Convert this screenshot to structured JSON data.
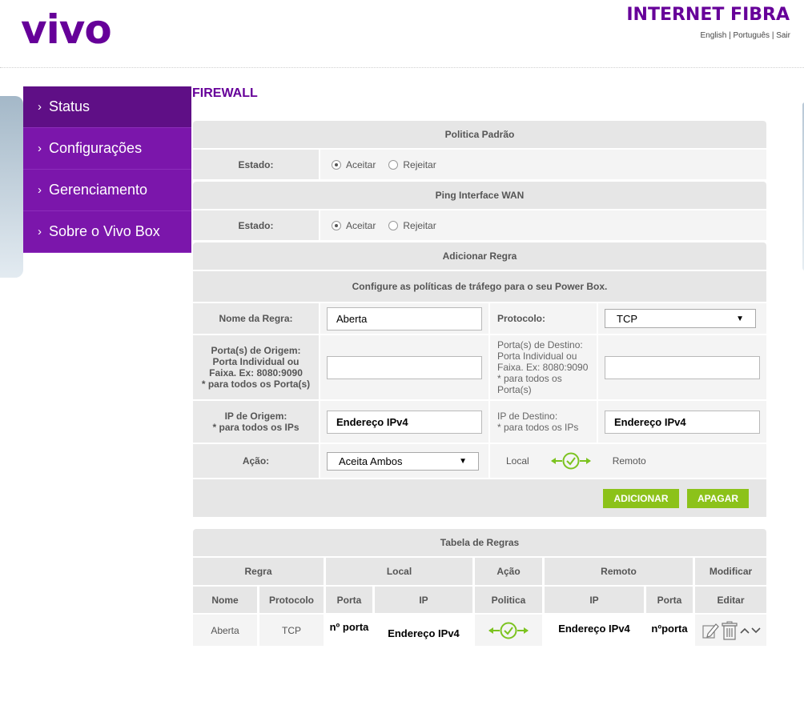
{
  "header": {
    "logo": "vivo",
    "brand": "INTERNET FIBRA",
    "languages": [
      "English",
      "Português",
      "Sair"
    ],
    "separator": " | "
  },
  "sidebar": {
    "items": [
      {
        "label": "Status",
        "active": true
      },
      {
        "label": "Configurações",
        "active": false
      },
      {
        "label": "Gerenciamento",
        "active": false
      },
      {
        "label": "Sobre o Vivo Box",
        "active": false
      }
    ]
  },
  "page": {
    "title": "FIREWALL"
  },
  "policy": {
    "header": "Politica Padrão",
    "state_label": "Estado:",
    "options": [
      "Aceitar",
      "Rejeitar"
    ],
    "selected": "Aceitar"
  },
  "ping": {
    "header": "Ping Interface WAN",
    "state_label": "Estado:",
    "options": [
      "Aceitar",
      "Rejeitar"
    ],
    "selected": "Aceitar"
  },
  "add_rule": {
    "header": "Adicionar Regra",
    "subheader": "Configure as políticas de tráfego para o seu Power Box.",
    "rule_name_label": "Nome da Regra:",
    "rule_name_value": "Aberta",
    "protocol_label": "Protocolo:",
    "protocol_value": "TCP",
    "src_ports_label": [
      "Porta(s) de Origem:",
      "Porta Individual ou",
      "Faixa. Ex: 8080:9090",
      "* para todos os Porta(s)"
    ],
    "src_ports_value": "",
    "dst_ports_label": [
      "Porta(s) de Destino:",
      "Porta Individual ou",
      "Faixa. Ex: 8080:9090",
      "* para todos os",
      "Porta(s)"
    ],
    "dst_ports_value": "",
    "src_ip_label": [
      "IP de Origem:",
      "* para todos os IPs"
    ],
    "src_ip_value": "Endereço IPv4",
    "dst_ip_label": [
      "IP de Destino:",
      "* para todos os IPs"
    ],
    "dst_ip_value": "Endereço IPv4",
    "action_label": "Ação:",
    "action_value": "Aceita Ambos",
    "local_label": "Local",
    "remote_label": "Remoto",
    "add_button": "ADICIONAR",
    "clear_button": "APAGAR"
  },
  "rules_table": {
    "header": "Tabela de Regras",
    "groups": [
      "Regra",
      "Local",
      "Ação",
      "Remoto",
      "Modificar"
    ],
    "columns": [
      "Nome",
      "Protocolo",
      "Porta",
      "IP",
      "Politica",
      "IP",
      "Porta",
      "Editar"
    ],
    "rows": [
      {
        "name": "Aberta",
        "protocol": "TCP",
        "local_port": "nº porta",
        "local_ip": "Endereço IPv4",
        "remote_ip": "Endereço IPv4",
        "remote_port": "nºporta"
      }
    ]
  },
  "colors": {
    "brand_purple": "#660099",
    "nav_purple": "#7b16ab",
    "nav_active": "#5f0f86",
    "button_green": "#8cc21a",
    "icon_green": "#7cc320"
  }
}
